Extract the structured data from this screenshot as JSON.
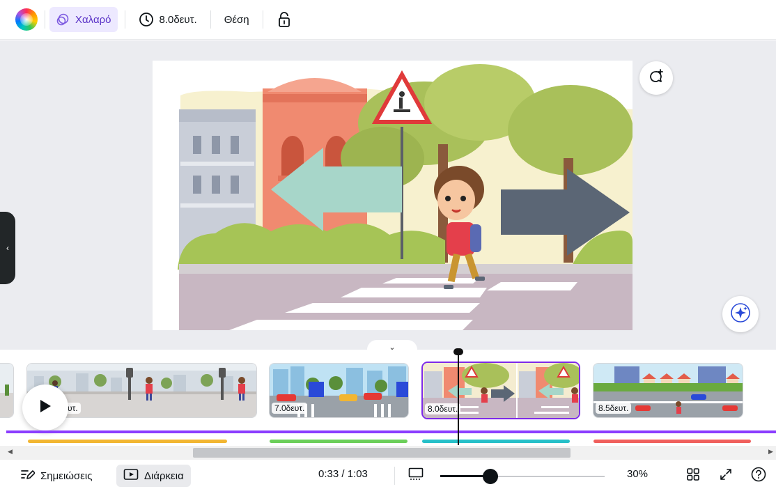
{
  "toolbar": {
    "style_label": "Χαλαρό",
    "duration_label": "8.0δευτ.",
    "position_label": "Θέση",
    "icons": [
      "color-wheel-icon",
      "style-icon",
      "clock-icon",
      "lock-icon"
    ]
  },
  "canvas": {
    "icons": [
      "comment-add-icon",
      "magic-sparkle-icon",
      "collapse-chevron-icon",
      "side-panel-chevron-icon"
    ]
  },
  "timeline": {
    "clips": [
      {
        "duration": "υτ.",
        "selected": false
      },
      {
        "duration": "7.0δευτ.",
        "selected": false
      },
      {
        "duration": "8.0δευτ.",
        "selected": true
      },
      {
        "duration": "8.5δευτ.",
        "selected": false
      }
    ],
    "audio_colors": [
      "#f2b632",
      "#6ccf5a",
      "#27c0c9",
      "#f0605d"
    ],
    "accent": "#8b3dff"
  },
  "bottom": {
    "notes_label": "Σημειώσεις",
    "duration_label": "Διάρκεια",
    "time": "0:33 / 1:03",
    "zoom": "30%",
    "zoom_fraction": 0.3
  }
}
